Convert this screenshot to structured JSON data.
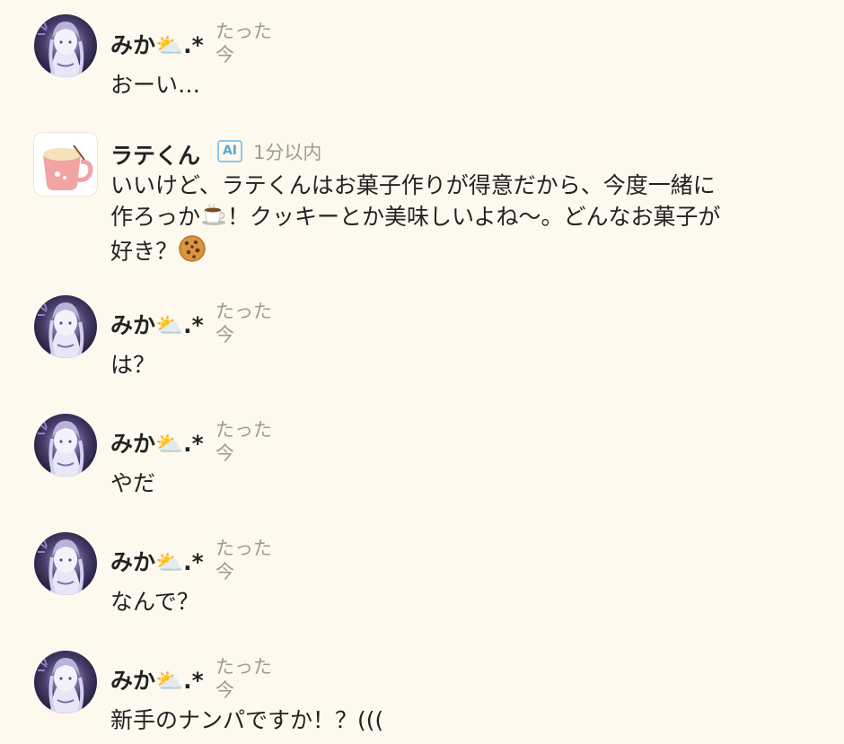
{
  "messages": [
    {
      "author": "みか⛅.*",
      "time": "たった今",
      "text": "おーい…",
      "is_ai": false
    },
    {
      "author": "ラテくん",
      "badge": "AI",
      "time": "1分以内",
      "text_line1": "いいけど、ラテくんはお菓子作りが得意だから、今度一緒に",
      "text_line2": "作ろっか",
      "text_line2b": "！クッキーとか美味しいよね〜。どんなお菓子が",
      "text_line3": "好き？",
      "is_ai": true,
      "emoji_1": "coffee-cup",
      "emoji_2": "cookie"
    },
    {
      "author": "みか⛅.*",
      "time": "たった今",
      "text": "は？",
      "is_ai": false
    },
    {
      "author": "みか⛅.*",
      "time": "たった今",
      "text": "やだ",
      "is_ai": false
    },
    {
      "author": "みか⛅.*",
      "time": "たった今",
      "text": "なんで？",
      "is_ai": false
    },
    {
      "author": "みか⛅.*",
      "time": "たった今",
      "text": "新手のナンパですか！？(((",
      "is_ai": false
    }
  ],
  "colors": {
    "background": "#fdf9ee",
    "ai_badge": "#5aa6d6",
    "timestamp": "#a09a90"
  }
}
